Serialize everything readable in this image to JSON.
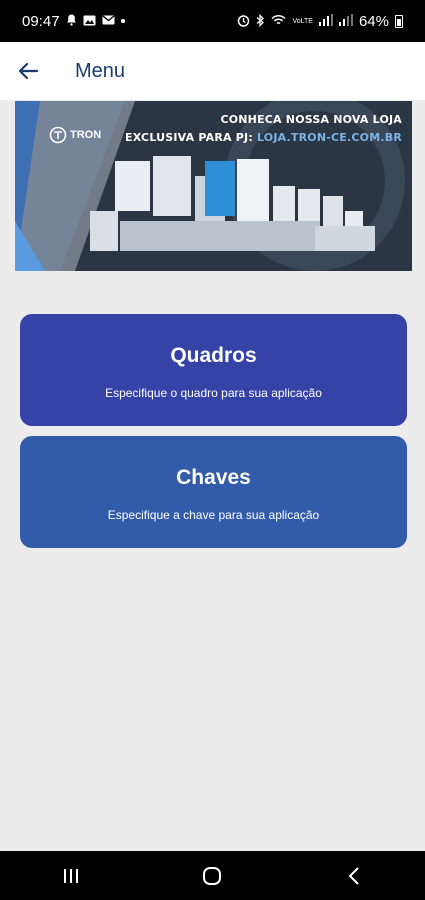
{
  "status_bar": {
    "time": "09:47",
    "battery": "64%",
    "network_label": "VoLTE"
  },
  "app_bar": {
    "title": "Menu",
    "back_icon": "arrow-left-icon"
  },
  "banner": {
    "brand": "TRON",
    "line1": "CONHECA NOSSA NOVA LOJA",
    "line2_prefix": "EXCLUSIVA PARA PJ: ",
    "line2_link": "LOJA.TRON-CE.COM.BR"
  },
  "menu": [
    {
      "title": "Quadros",
      "subtitle": "Especifique o quadro para sua aplicação"
    },
    {
      "title": "Chaves",
      "subtitle": "Especifique a chave para sua aplicação"
    }
  ],
  "colors": {
    "accent_dark": "#1d3c6e",
    "card_quadros": "#3542a6",
    "card_chaves": "#325caa",
    "background": "#ececec"
  },
  "nav_bar": {
    "buttons": [
      "recent-apps-icon",
      "home-icon",
      "back-chevron-icon"
    ]
  }
}
